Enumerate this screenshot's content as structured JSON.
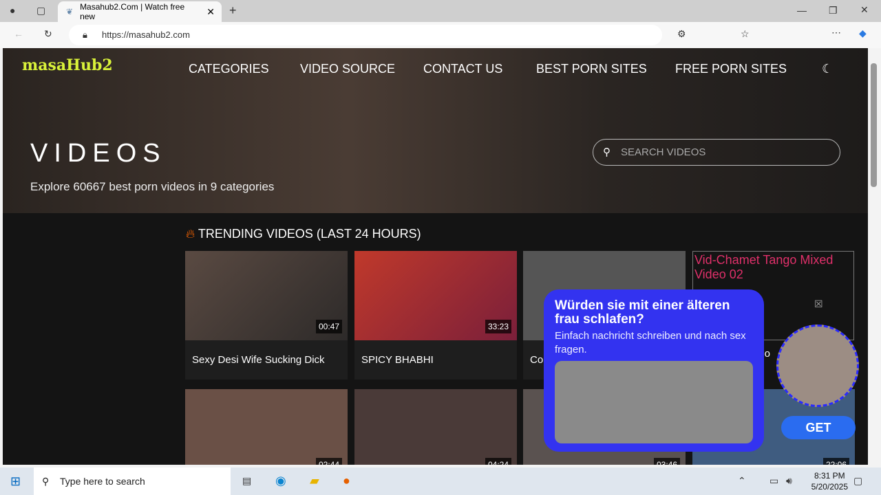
{
  "browser": {
    "tab_title": "Masahub2.Com | Watch free new",
    "url": "https://masahub2.com"
  },
  "site": {
    "logo": "masaHub2",
    "nav": [
      "CATEGORIES",
      "VIDEO SOURCE",
      "CONTACT US",
      "BEST PORN SITES",
      "FREE PORN SITES"
    ],
    "heading": "VIDEOS",
    "subheading": "Explore 60667 best porn videos in 9 categories",
    "search_placeholder": "SEARCH  VIDEOS",
    "trending": "TRENDING VIDEOS (LAST 24 HOURS)"
  },
  "videos": [
    {
      "title": "Sexy Desi Wife Sucking Dick",
      "duration": "00:47"
    },
    {
      "title": "SPICY BHABHI",
      "duration": "33:23"
    },
    {
      "title": "Col",
      "duration": ""
    },
    {
      "title": "",
      "duration": "02:44"
    },
    {
      "title": "",
      "duration": "04:24"
    },
    {
      "title": "",
      "duration": "03:46"
    },
    {
      "title": "",
      "duration": "22:06"
    }
  ],
  "ad": {
    "alt": "Vid-Chamet Tango Mixed Video 02",
    "partial": "ngo"
  },
  "popup": {
    "title": "Würden sie mit einer älteren frau schlafen?",
    "text": "Einfach nachricht schreiben und nach sex fragen.",
    "button": "GET"
  },
  "taskbar": {
    "search": "Type here to search",
    "time": "8:31 PM",
    "date": "5/20/2025"
  }
}
